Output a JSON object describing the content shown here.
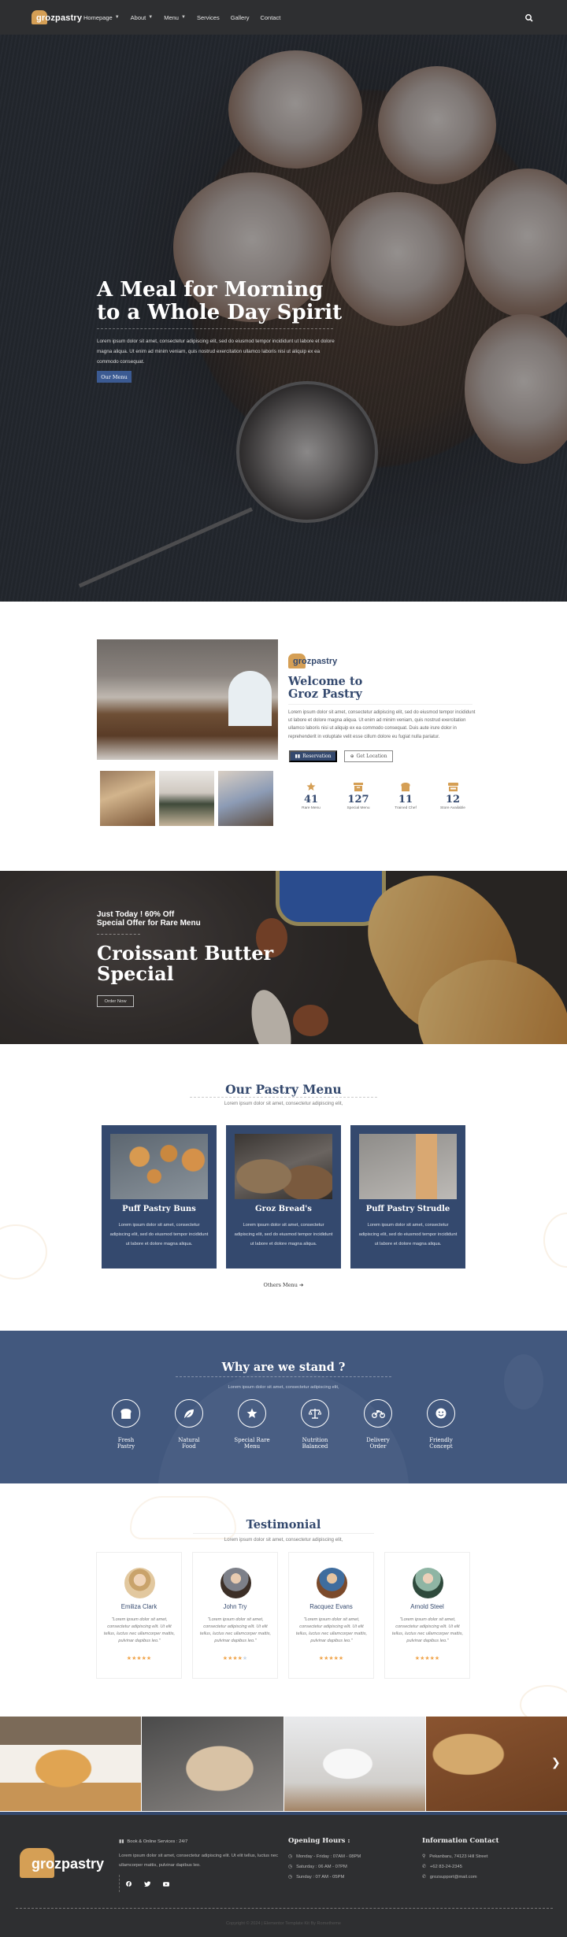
{
  "header": {
    "logo": "grozpastry",
    "nav": [
      {
        "label": "Homepage",
        "dropdown": true
      },
      {
        "label": "About",
        "dropdown": true
      },
      {
        "label": "Menu",
        "dropdown": true
      },
      {
        "label": "Services",
        "dropdown": false
      },
      {
        "label": "Gallery",
        "dropdown": false
      },
      {
        "label": "Contact",
        "dropdown": false
      }
    ],
    "search_icon": "search-icon"
  },
  "hero": {
    "title_line1": "A Meal for Morning",
    "title_line2": "to a Whole Day Spirit",
    "text": "Lorem ipsum dolor sit amet, consectetur adipiscing elit, sed do eiusmod tempor incididunt ut labore et dolore magna aliqua. Ut enim ad minim veniam, quis nostrud exercitation ullamco laboris nisi ut aliquip ex ea commodo consequat.",
    "button": "Our Menu"
  },
  "welcome": {
    "logo": "grozpastry",
    "title_line1": "Welcome to",
    "title_line2": "Groz Pastry",
    "text": "Lorem ipsum dolor sit amet, consectetur adipiscing elit, sed do eiusmod tempor incididunt ut labore et dolore magna aliqua. Ut enim ad minim veniam, quis nostrud exercitation ullamco laboris nisi ut aliquip ex ea commodo consequat. Duis aute irure dolor in reprehenderit in voluptate velit esse cillum dolore eu fugiat nulla pariatur.",
    "reservation_button": "Reservation",
    "location_button": "Get Location",
    "stats": [
      {
        "icon": "star-icon",
        "value": "41",
        "label": "Rare Menu"
      },
      {
        "icon": "box-icon",
        "value": "127",
        "label": "Special Menu"
      },
      {
        "icon": "bread-icon",
        "value": "11",
        "label": "Trained Chef"
      },
      {
        "icon": "store-icon",
        "value": "12",
        "label": "Store Available"
      }
    ]
  },
  "offer": {
    "sub_line1": "Just Today ! 60% Off",
    "sub_line2": "Special Offer for Rare Menu",
    "title_line1": "Croissant Butter",
    "title_line2": "Special",
    "button": "Order Now"
  },
  "pastry_menu": {
    "title": "Our Pastry Menu",
    "subtitle": "Lorem ipsum dolor sit amet, consectetur adipiscing elit,",
    "items": [
      {
        "title": "Puff Pastry Buns",
        "text": "Lorem ipsum dolor sit amet, consectetur adipiscing elit, sed do eiusmod tempor incididunt ut labore et dolore magna aliqua."
      },
      {
        "title": "Groz Bread's",
        "text": "Lorem ipsum dolor sit amet, consectetur adipiscing elit, sed do eiusmod tempor incididunt ut labore et dolore magna aliqua."
      },
      {
        "title": "Puff Pastry Strudle",
        "text": "Lorem ipsum dolor sit amet, consectetur adipiscing elit, sed do eiusmod tempor incididunt ut labore et dolore magna aliqua."
      }
    ],
    "others_link": "Others Menu"
  },
  "why": {
    "title": "Why are we stand ?",
    "subtitle": "Lorem ipsum dolor sit amet, consectetur adipiscing elit,",
    "features": [
      {
        "icon": "bread-icon",
        "line1": "Fresh",
        "line2": "Pastry"
      },
      {
        "icon": "leaf-icon",
        "line1": "Natural",
        "line2": "Food"
      },
      {
        "icon": "star-icon",
        "line1": "Special Rare",
        "line2": "Menu"
      },
      {
        "icon": "balance-scale-icon",
        "line1": "Nutrition",
        "line2": "Balanced"
      },
      {
        "icon": "motorcycle-icon",
        "line1": "Delivery",
        "line2": "Order"
      },
      {
        "icon": "smile-icon",
        "line1": "Friendly",
        "line2": "Concept"
      }
    ]
  },
  "testimonial": {
    "title": "Testimonial",
    "subtitle": "Lorem ipsum dolor sit amet, consectetur adipiscing elit,",
    "items": [
      {
        "name": "Emiliza Clark",
        "quote": "\"Lorem ipsum dolor sit amet, consectetur adipiscing elit. Ut elit tellus, luctus nec ullamcorper mattis, pulvinar dapibus leo.\"",
        "rating": 5
      },
      {
        "name": "John Try",
        "quote": "\"Lorem ipsum dolor sit amet, consectetur adipiscing elit. Ut elit tellus, luctus nec ullamcorper mattis, pulvinar dapibus leo.\"",
        "rating": 4
      },
      {
        "name": "Racquez Evans",
        "quote": "\"Lorem ipsum dolor sit amet, consectetur adipiscing elit. Ut elit tellus, luctus nec ullamcorper mattis, pulvinar dapibus leo.\"",
        "rating": 5
      },
      {
        "name": "Arnold Steel",
        "quote": "\"Lorem ipsum dolor sit amet, consectetur adipiscing elit. Ut elit tellus, luctus nec ullamcorper mattis, pulvinar dapibus leo.\"",
        "rating": 5
      }
    ]
  },
  "footer": {
    "logo": "grozpastry",
    "book_label": "Book & Online Services : 24/7",
    "description": "Lorem ipsum dolor sit amet, consectetur adipiscing elit. Ut elit tellus, luctus nec ullamcorper mattis, pulvinar dapibus leo.",
    "social": [
      "facebook-icon",
      "twitter-icon",
      "youtube-icon"
    ],
    "hours_title": "Opening Hours :",
    "hours": [
      "Monday - Friday : 07AM - 08PM",
      "Saturday : 06 AM - 07PM",
      "Sunday : 07 AM - 05PM"
    ],
    "contact_title": "Information Contact",
    "contact": [
      {
        "icon": "map-pin-icon",
        "text": "Pekanbaru, 74123 Hill Street"
      },
      {
        "icon": "phone-icon",
        "text": "+62 83-24-2345"
      },
      {
        "icon": "phone-icon",
        "text": "grozsupport@mail.com"
      }
    ],
    "copyright": "Copyright © 2024 | Elementor Template Kit By Rometheme"
  },
  "colors": {
    "brand_blue": "#34496e",
    "why_bg": "#42587e",
    "accent_gold": "#d59f55",
    "dark": "#2e2f31",
    "star": "#f0a44b"
  }
}
